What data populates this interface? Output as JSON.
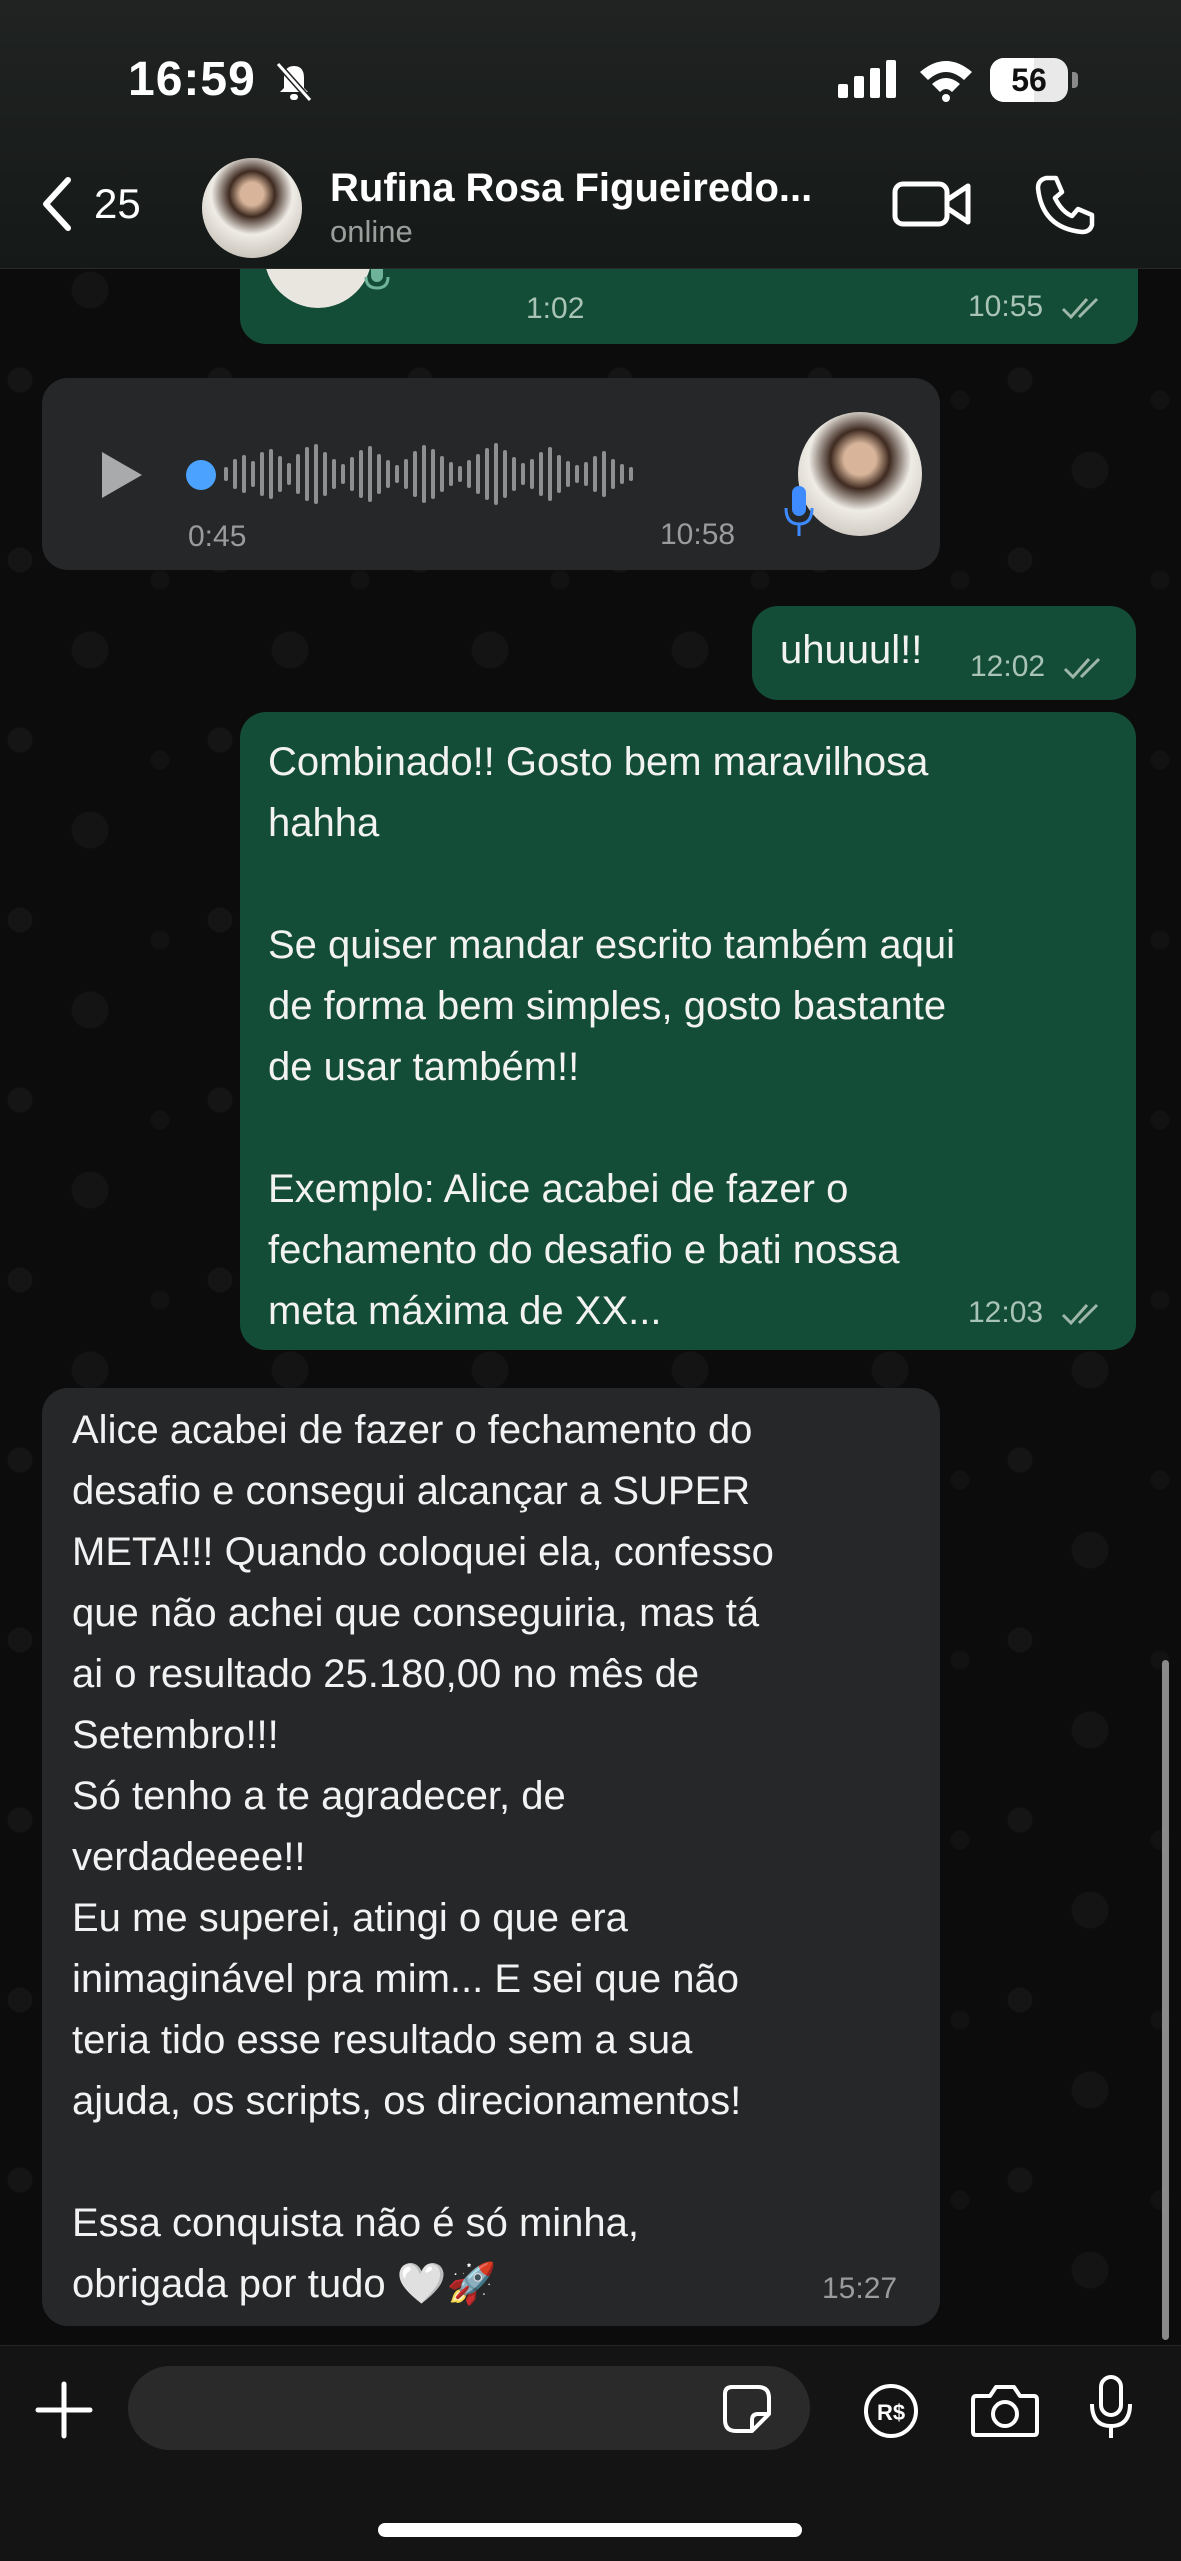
{
  "status_bar": {
    "time": "16:59",
    "battery": "56",
    "battery_level": 0.56
  },
  "header": {
    "back_count": "25",
    "contact_name": "Rufina Rosa Figueiredo...",
    "contact_status": "online"
  },
  "messages": [
    {
      "type": "audio",
      "direction": "out",
      "duration": "1:02",
      "time": "10:55",
      "read": true
    },
    {
      "type": "audio",
      "direction": "in",
      "duration": "0:45",
      "time": "10:58"
    },
    {
      "type": "text",
      "direction": "out",
      "text": "uhuuul!!",
      "time": "12:02",
      "read": true
    },
    {
      "type": "text",
      "direction": "out",
      "text": "Combinado!! Gosto bem maravilhosa\nhahha\n\nSe quiser mandar escrito também aqui\nde forma bem simples, gosto bastante\nde usar também!!\n\nExemplo: Alice acabei de fazer o\nfechamento do desafio e bati nossa\nmeta máxima de XX...",
      "time": "12:03",
      "read": true
    },
    {
      "type": "text",
      "direction": "in",
      "text": "Alice acabei de fazer o fechamento do\ndesafio e consegui alcançar a SUPER\nMETA!!! Quando coloquei ela, confesso\nque não achei que conseguiria, mas tá\nai o resultado 25.180,00 no mês de\nSetembro!!!\nSó tenho a te agradecer, de\nverdadeeee!!\nEu me superei, atingi o que era\ninimaginável pra mim... E sei que não\nteria tido esse resultado sem a sua\najuda, os scripts, os direcionamentos!\n\nEssa conquista não é só minha,\nobrigada por tudo 🤍🚀",
      "time": "15:27"
    }
  ],
  "input": {
    "placeholder": ""
  },
  "colors": {
    "outgoing_bubble": "#144d37",
    "incoming_bubble": "#262728",
    "read_ticks": "#9fb6ab"
  },
  "icons": [
    "bell-slash-icon",
    "signal-icon",
    "wifi-icon",
    "battery-icon",
    "chevron-left-icon",
    "video-camera-icon",
    "phone-icon",
    "play-icon",
    "microphone-icon",
    "plus-icon",
    "sticker-icon",
    "payment-icon",
    "camera-icon"
  ]
}
